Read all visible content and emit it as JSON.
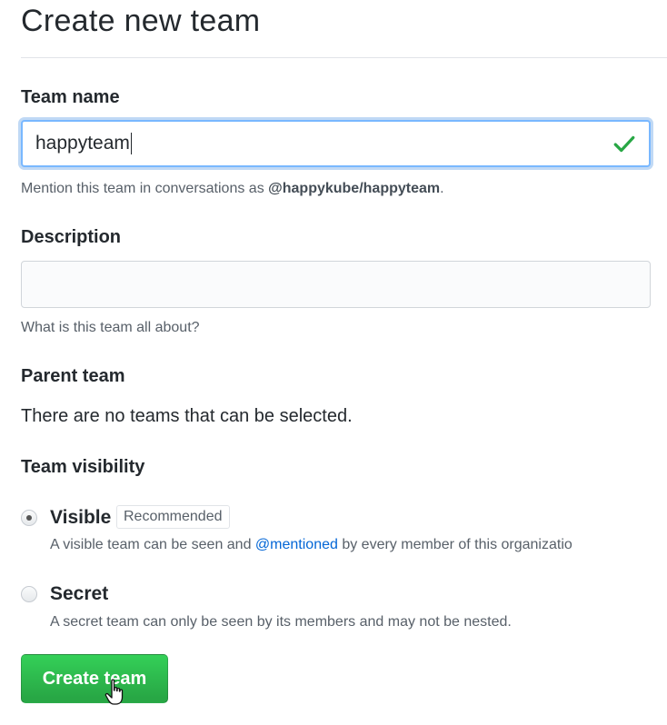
{
  "page": {
    "title": "Create new team"
  },
  "team_name": {
    "label": "Team name",
    "value": "happyteam",
    "status_icon": "check-icon",
    "hint_prefix": "Mention this team in conversations as ",
    "hint_mention": "@happykube/happyteam",
    "hint_suffix": "."
  },
  "description": {
    "label": "Description",
    "value": "",
    "hint": "What is this team all about?"
  },
  "parent_team": {
    "label": "Parent team",
    "message": "There are no teams that can be selected."
  },
  "visibility": {
    "label": "Team visibility",
    "options": [
      {
        "title": "Visible",
        "badge": "Recommended",
        "checked": true,
        "note_prefix": "A visible team can be seen and ",
        "note_link": "@mentioned",
        "note_suffix": " by every member of this organizatio"
      },
      {
        "title": "Secret",
        "checked": false,
        "note": "A secret team can only be seen by its members and may not be nested."
      }
    ]
  },
  "actions": {
    "create_label": "Create team"
  },
  "colors": {
    "primary_button": "#28a745",
    "focus_border": "#79b8ff",
    "success_check": "#28a745",
    "link": "#0366d6"
  }
}
